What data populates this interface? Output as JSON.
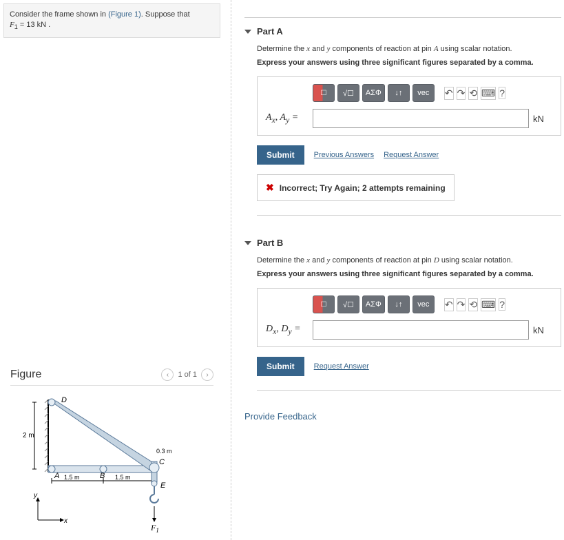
{
  "problem": {
    "prefix": "Consider the frame shown in ",
    "figure_link": "(Figure 1)",
    "suffix": ". Suppose that",
    "var": "F",
    "sub": "1",
    "eq": " = 13 ",
    "unit": "kN",
    "period": " ."
  },
  "figure": {
    "title": "Figure",
    "counter": "1 of 1",
    "labels": {
      "D": "D",
      "A": "A",
      "B": "B",
      "C": "C",
      "E": "E",
      "F1": "F",
      "F1sub": "1"
    },
    "dims": {
      "h2m": "2 m",
      "w15a": "1.5 m",
      "w15b": "1.5 m",
      "h03": "0.3 m",
      "x": "x",
      "y": "y"
    }
  },
  "parts": {
    "a": {
      "title": "Part A",
      "desc_pre": "Determine the ",
      "desc_x": "x",
      "desc_mid1": " and ",
      "desc_y": "y",
      "desc_mid2": " components of reaction at pin ",
      "desc_pin": "A",
      "desc_post": " using scalar notation.",
      "bold": "Express your answers using three significant figures separated by a comma.",
      "answer_label_html": "A_x, A_y =",
      "answer_label_display": "Aₓ, A_y =",
      "unit": "kN",
      "submit": "Submit",
      "prev_link": "Previous Answers",
      "req_link": "Request Answer",
      "feedback": "Incorrect; Try Again; 2 attempts remaining"
    },
    "b": {
      "title": "Part B",
      "desc_pre": "Determine the ",
      "desc_x": "x",
      "desc_mid1": " and ",
      "desc_y": "y",
      "desc_mid2": " components of reaction at pin ",
      "desc_pin": "D",
      "desc_post": " using scalar notation.",
      "bold": "Express your answers using three significant figures separated by a comma.",
      "answer_label_display": "Dₓ, D_y =",
      "unit": "kN",
      "submit": "Submit",
      "req_link": "Request Answer"
    }
  },
  "toolbar": {
    "sqrt": "√☐",
    "greek": "ΑΣΦ",
    "arrows": "↓↑",
    "vec": "vec",
    "undo": "↶",
    "redo": "↷",
    "reset": "⟲",
    "keyboard": "⌨",
    "help": "?"
  },
  "feedback_link": "Provide Feedback"
}
